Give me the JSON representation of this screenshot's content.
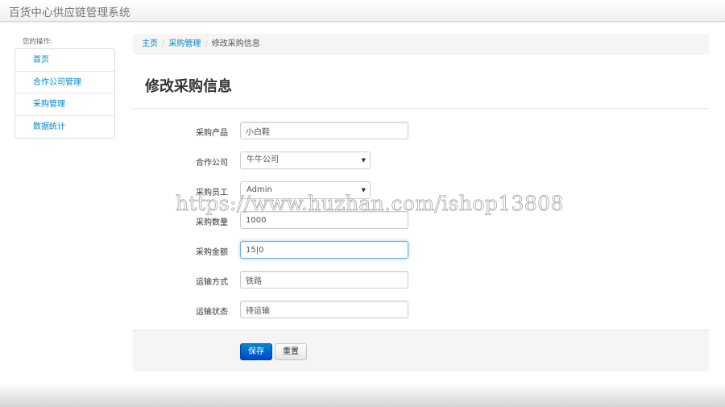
{
  "app": {
    "title": "百货中心供应链管理系统"
  },
  "sidebar": {
    "label": "您的操作:",
    "items": [
      {
        "label": "首页"
      },
      {
        "label": "合作公司管理"
      },
      {
        "label": "采购管理"
      },
      {
        "label": "数据统计"
      }
    ]
  },
  "breadcrumb": {
    "home": "主页",
    "section": "采购管理",
    "current": "修改采购信息",
    "separator": "/"
  },
  "page": {
    "title": "修改采购信息"
  },
  "form": {
    "product": {
      "label": "采购产品",
      "value": "小白鞋"
    },
    "company": {
      "label": "合作公司",
      "value": "牛牛公司"
    },
    "employee": {
      "label": "采购员工",
      "value": "Admin"
    },
    "quantity": {
      "label": "采购数量",
      "value": "1000"
    },
    "amount": {
      "label": "采购金额",
      "value": "15|0"
    },
    "transport": {
      "label": "运输方式",
      "value": "铁路"
    },
    "status": {
      "label": "运输状态",
      "value": "待运输"
    },
    "save_label": "保存",
    "reset_label": "重置"
  },
  "watermark": {
    "text": "https://www.huzhan.com/ishop13808"
  },
  "colors": {
    "link": "#0088cc",
    "primary": "#0055cc",
    "focus": "#66afe9"
  },
  "icons": {
    "select_arrow": "caret-down-icon"
  }
}
